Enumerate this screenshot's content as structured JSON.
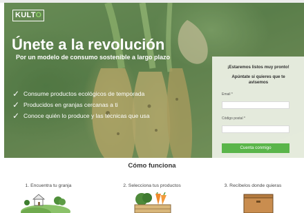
{
  "brand": {
    "logo_text_a": "KULT",
    "logo_text_b": "O"
  },
  "hero": {
    "headline": "Únete a la revolución",
    "subheadline": "Por un modelo de consumo sostenible a largo plazo",
    "benefits": [
      "Consume productos ecológicos de temporada",
      "Producidos en granjas cercanas a ti",
      "Conoce quién lo produce y las técnicas que usa"
    ]
  },
  "signup_form": {
    "title": "¡Estaremos listos muy pronto!",
    "subtitle": "Apúntate si quieres que te avisemos",
    "email_label": "Email *",
    "email_value": "",
    "postcode_label": "Código postal *",
    "postcode_value": "",
    "submit_label": "Cuenta conmigo"
  },
  "how_it_works": {
    "title": "Cómo funciona",
    "steps": [
      {
        "label": "1. Encuentra tu granja",
        "icon": "farm-icon"
      },
      {
        "label": "2. Selecciona tus productos",
        "icon": "vegetables-basket-icon"
      },
      {
        "label": "3. Recíbelos donde quieras",
        "icon": "delivery-box-icon"
      }
    ]
  },
  "colors": {
    "accent_green": "#5ab54a",
    "logo_accent": "#8fd36a",
    "hero_tint": "#58804a"
  }
}
